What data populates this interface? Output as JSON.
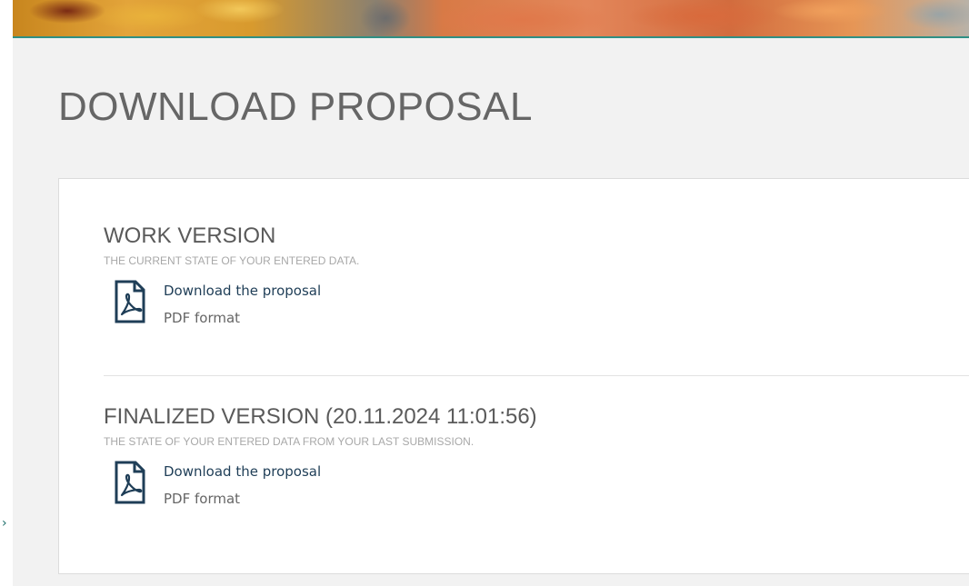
{
  "page": {
    "title": "DOWNLOAD PROPOSAL"
  },
  "sections": [
    {
      "title": "WORK VERSION",
      "subtitle": "THE CURRENT STATE OF YOUR ENTERED DATA.",
      "link_label": "Download the proposal",
      "format_label": "PDF format",
      "icon": "pdf-file-icon"
    },
    {
      "title": "FINALIZED VERSION (20.11.2024 11:01:56)",
      "subtitle": "THE STATE OF YOUR ENTERED DATA FROM YOUR LAST SUBMISSION.",
      "link_label": "Download the proposal",
      "format_label": "PDF format",
      "icon": "pdf-file-icon"
    }
  ],
  "colors": {
    "accent": "#2f8f84",
    "link": "#1f3e57",
    "icon": "#1f3e57",
    "title": "#666666",
    "subtitle": "#a8a8a8"
  },
  "icons": {
    "left_marker": "chevron-right-icon"
  },
  "left_marker_glyph": "›"
}
